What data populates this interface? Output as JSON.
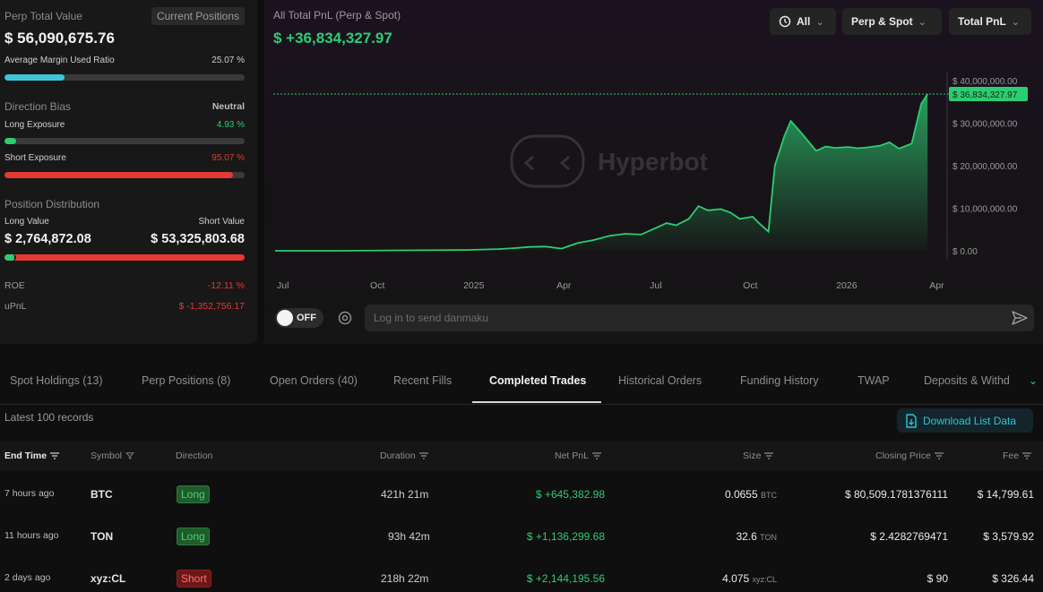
{
  "left": {
    "perp_total_label": "Perp Total Value",
    "current_positions_button": "Current Positions",
    "perp_total_value": "$ 56,090,675.76",
    "margin_label": "Average Margin Used Ratio",
    "margin_value": "25.07 %",
    "margin_ratio": 0.2507,
    "direction_bias_label": "Direction Bias",
    "direction_bias_value": "Neutral",
    "long_exposure_label": "Long Exposure",
    "long_exposure_value": "4.93 %",
    "long_exposure_ratio": 0.0493,
    "short_exposure_label": "Short Exposure",
    "short_exposure_value": "95.07 %",
    "short_exposure_ratio": 0.9507,
    "position_distribution_label": "Position Distribution",
    "long_value_label": "Long Value",
    "short_value_label": "Short Value",
    "long_value": "$ 2,764,872.08",
    "short_value": "$ 53,325,803.68",
    "long_value_ratio": 0.0493,
    "roe_label": "ROE",
    "roe_value": "-12.11 %",
    "upnl_label": "uPnL",
    "upnl_value": "$ -1,352,756.17"
  },
  "chart": {
    "title": "All Total PnL (Perp & Spot)",
    "value": "$ +36,834,327.97",
    "filters": {
      "range": "All",
      "scope": "Perp & Spot",
      "metric": "Total PnL"
    },
    "watermark": "Hyperbot",
    "danmaku_toggle": "OFF",
    "danmaku_placeholder": "Log in to send danmaku"
  },
  "chart_data": {
    "type": "area",
    "x_ticks": [
      "Jul",
      "Oct",
      "2025",
      "Apr",
      "Jul",
      "Oct",
      "2026",
      "Apr"
    ],
    "y_ticks": [
      "$ 40,000,000.00",
      "$ 30,000,000.00",
      "$ 20,000,000.00",
      "$ 10,000,000.00",
      "$ 0.00"
    ],
    "ylim": [
      0,
      40000000
    ],
    "current_value_label": "$ 36,834,327.97",
    "current_value": 36834327.97,
    "series": [
      {
        "x_index": [
          0,
          2,
          4,
          6,
          7,
          7.5,
          8,
          8.5,
          9,
          9.5,
          10,
          10.5,
          11,
          11.5,
          12,
          12.3,
          12.6,
          13,
          13.3,
          13.6,
          14,
          14.3,
          14.6,
          15,
          15.2,
          15.5,
          15.7,
          16,
          16.2,
          16.5,
          17,
          17.3,
          17.6,
          18,
          18.3,
          18.6,
          19,
          19.3,
          19.6,
          20,
          20.3,
          20.5
        ],
        "values": [
          0,
          0,
          100000,
          200000,
          400000,
          600000,
          900000,
          1000000,
          500000,
          1800000,
          2500000,
          3500000,
          4000000,
          3800000,
          5500000,
          6500000,
          6000000,
          7500000,
          10500000,
          9500000,
          9800000,
          9000000,
          7500000,
          8000000,
          6500000,
          4500000,
          20000000,
          27000000,
          30500000,
          28000000,
          23500000,
          24500000,
          24200000,
          24400000,
          24100000,
          24300000,
          24700000,
          25500000,
          24000000,
          25200000,
          34500000,
          36834327.97
        ]
      }
    ]
  },
  "tabs": [
    {
      "label": "Spot Holdings (13)"
    },
    {
      "label": "Perp Positions (8)"
    },
    {
      "label": "Open Orders (40)"
    },
    {
      "label": "Recent Fills"
    },
    {
      "label": "Completed Trades"
    },
    {
      "label": "Historical Orders"
    },
    {
      "label": "Funding History"
    },
    {
      "label": "TWAP"
    },
    {
      "label": "Deposits & Withd"
    }
  ],
  "records_label": "Latest 100 records",
  "download_button": "Download List Data",
  "table": {
    "headers": {
      "end_time": "End Time",
      "symbol": "Symbol",
      "direction": "Direction",
      "duration": "Duration",
      "net_pnl": "Net PnL",
      "size": "Size",
      "closing_price": "Closing Price",
      "fee": "Fee"
    },
    "rows": [
      {
        "end_time": "7 hours ago",
        "symbol": "BTC",
        "direction": "Long",
        "duration": "421h 21m",
        "net_pnl": "$ +645,382.98",
        "size": "0.0655",
        "size_unit": "BTC",
        "closing_price": "$ 80,509.1781376111",
        "fee": "$ 14,799.61"
      },
      {
        "end_time": "11 hours ago",
        "symbol": "TON",
        "direction": "Long",
        "duration": "93h 42m",
        "net_pnl": "$ +1,136,299.68",
        "size": "32.6",
        "size_unit": "TON",
        "closing_price": "$ 2.4282769471",
        "fee": "$ 3,579.92"
      },
      {
        "end_time": "2 days ago",
        "symbol": "xyz:CL",
        "direction": "Short",
        "duration": "218h 22m",
        "net_pnl": "$ +2,144,195.56",
        "size": "4.075",
        "size_unit": "xyz:CL",
        "closing_price": "$ 90",
        "fee": "$ 326.44"
      }
    ]
  },
  "colors": {
    "accent_green": "#2ecc71",
    "accent_red": "#e53935",
    "accent_cyan": "#2ec4d6",
    "margin_bar": "#3ec6d8"
  }
}
